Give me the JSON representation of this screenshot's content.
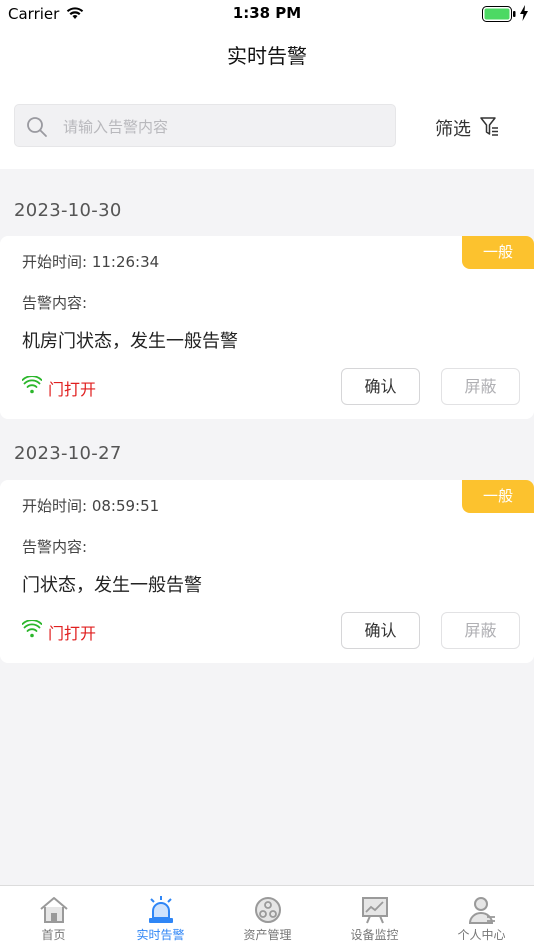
{
  "status_bar": {
    "carrier": "Carrier",
    "time": "1:38 PM"
  },
  "nav": {
    "title": "实时告警"
  },
  "search": {
    "placeholder": "请输入告警内容"
  },
  "filter": {
    "label": "筛选",
    "icon": "filter-icon"
  },
  "alarms": [
    {
      "date": "2023-10-30",
      "level": "一般",
      "start_time": "开始时间: 11:26:34",
      "content_label": "告警内容:",
      "content": "机房门状态，发生一般告警",
      "door_status": "门打开",
      "confirm_label": "确认",
      "shield_label": "屏蔽"
    },
    {
      "date": "2023-10-27",
      "level": "一般",
      "start_time": "开始时间: 08:59:51",
      "content_label": "告警内容:",
      "content": "门状态，发生一般告警",
      "door_status": "门打开",
      "confirm_label": "确认",
      "shield_label": "屏蔽"
    }
  ],
  "tabs": [
    {
      "label": "首页",
      "icon": "home-icon",
      "active": false
    },
    {
      "label": "实时告警",
      "icon": "alarm-icon",
      "active": true
    },
    {
      "label": "资产管理",
      "icon": "asset-icon",
      "active": false
    },
    {
      "label": "设备监控",
      "icon": "monitor-icon",
      "active": false
    },
    {
      "label": "个人中心",
      "icon": "user-icon",
      "active": false
    }
  ],
  "colors": {
    "accent": "#2f86f6",
    "badge": "#fcc22e",
    "door_open": "#e02020",
    "wifi_green": "#2bb62b"
  }
}
